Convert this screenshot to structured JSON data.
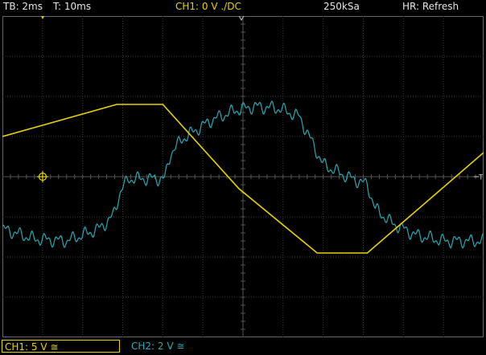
{
  "status_bar": {
    "timebase": "TB: 2ms",
    "trigger_time": "T: 10ms",
    "ch1_setting": "CH1: 0 V ./DC",
    "sample_rate": "250kSa",
    "mode": "HR: Refresh"
  },
  "channels": {
    "ch1": {
      "label": "CH1: 5 V ≅",
      "color": "#e7d400"
    },
    "ch2": {
      "label": "CH2: 2 V ≅",
      "color": "#2aa8b2"
    }
  },
  "markers": {
    "trigger_level": "T"
  },
  "chart_data": {
    "type": "line",
    "grid": true,
    "divisions": {
      "x": 12,
      "y": 8
    },
    "series": [
      {
        "color": "#e7d400",
        "points_div": [
          [
            0,
            1
          ],
          [
            2.85,
            1.8
          ],
          [
            4,
            1.8
          ],
          [
            5.9,
            -0.3
          ],
          [
            7.85,
            -1.9
          ],
          [
            9.1,
            -1.9
          ],
          [
            12,
            0.6
          ]
        ]
      },
      {
        "color": "#2aa8b2",
        "points_div": [
          [
            0,
            -1.3
          ],
          [
            0.8,
            -1.55
          ],
          [
            1.6,
            -1.6
          ],
          [
            2.4,
            -1.3
          ],
          [
            2.75,
            -1.0
          ],
          [
            2.95,
            -0.35
          ],
          [
            3.15,
            -0.05
          ],
          [
            3.6,
            -0.05
          ],
          [
            4.05,
            -0.05
          ],
          [
            4.2,
            0.6
          ],
          [
            4.5,
            0.95
          ],
          [
            5.2,
            1.4
          ],
          [
            5.8,
            1.65
          ],
          [
            6.3,
            1.75
          ],
          [
            6.9,
            1.7
          ],
          [
            7.4,
            1.5
          ],
          [
            7.7,
            0.9
          ],
          [
            8.0,
            0.3
          ],
          [
            8.6,
            0.0
          ],
          [
            9.1,
            -0.2
          ],
          [
            9.3,
            -0.8
          ],
          [
            9.7,
            -1.15
          ],
          [
            10.3,
            -1.45
          ],
          [
            11.0,
            -1.6
          ],
          [
            12.0,
            -1.6
          ]
        ],
        "ripple_div": 0.18
      }
    ]
  }
}
